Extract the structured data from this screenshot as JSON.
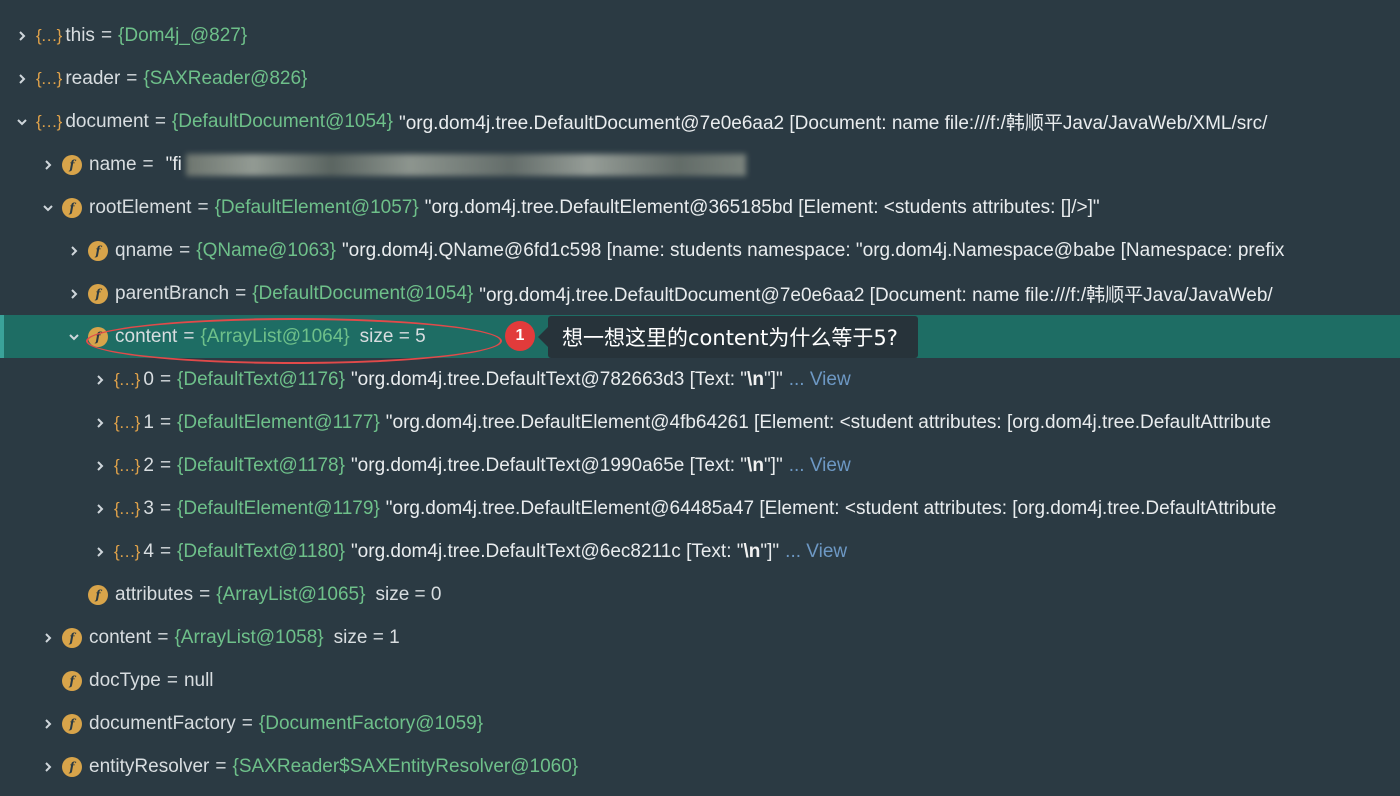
{
  "rows": [
    {
      "indent": 0,
      "arrow": "right",
      "icon": "obj",
      "key": "this",
      "ref": "{Dom4j_@827}"
    },
    {
      "indent": 0,
      "arrow": "right",
      "icon": "obj",
      "key": "reader",
      "ref": "{SAXReader@826}"
    },
    {
      "indent": 0,
      "arrow": "down",
      "icon": "obj",
      "key": "document",
      "ref": "{DefaultDocument@1054}",
      "str": "\"org.dom4j.tree.DefaultDocument@7e0e6aa2 [Document: name file:///f:/韩顺平Java/JavaWeb/XML/src/"
    },
    {
      "indent": 1,
      "arrow": "right",
      "icon": "field",
      "key": "name",
      "str": "\"fi",
      "blurred": true
    },
    {
      "indent": 1,
      "arrow": "down",
      "icon": "field",
      "key": "rootElement",
      "ref": "{DefaultElement@1057}",
      "str": "\"org.dom4j.tree.DefaultElement@365185bd [Element: <students attributes: []/>]\""
    },
    {
      "indent": 2,
      "arrow": "right",
      "icon": "field",
      "key": "qname",
      "ref": "{QName@1063}",
      "str": "\"org.dom4j.QName@6fd1c598 [name: students namespace: \"org.dom4j.Namespace@babe [Namespace: prefix"
    },
    {
      "indent": 2,
      "arrow": "right",
      "icon": "field",
      "key": "parentBranch",
      "ref": "{DefaultDocument@1054}",
      "str": "\"org.dom4j.tree.DefaultDocument@7e0e6aa2 [Document: name file:///f:/韩顺平Java/JavaWeb/"
    },
    {
      "indent": 2,
      "arrow": "down",
      "icon": "field",
      "key": "content",
      "ref": "{ArrayList@1064}",
      "size": "size = 5",
      "selected": true
    },
    {
      "indent": 3,
      "arrow": "right",
      "icon": "obj",
      "key": "0",
      "ref": "{DefaultText@1176}",
      "str": "\"org.dom4j.tree.DefaultText@782663d3 [Text: \"",
      "esc": "\\n",
      "str2": "    \"]\"",
      "view": "... View"
    },
    {
      "indent": 3,
      "arrow": "right",
      "icon": "obj",
      "key": "1",
      "ref": "{DefaultElement@1177}",
      "str": "\"org.dom4j.tree.DefaultElement@4fb64261 [Element: <student attributes: [org.dom4j.tree.DefaultAttribute"
    },
    {
      "indent": 3,
      "arrow": "right",
      "icon": "obj",
      "key": "2",
      "ref": "{DefaultText@1178}",
      "str": "\"org.dom4j.tree.DefaultText@1990a65e [Text: \"",
      "esc": "\\n",
      "str2": "    \"]\"",
      "view": "... View"
    },
    {
      "indent": 3,
      "arrow": "right",
      "icon": "obj",
      "key": "3",
      "ref": "{DefaultElement@1179}",
      "str": "\"org.dom4j.tree.DefaultElement@64485a47 [Element: <student attributes: [org.dom4j.tree.DefaultAttribute"
    },
    {
      "indent": 3,
      "arrow": "right",
      "icon": "obj",
      "key": "4",
      "ref": "{DefaultText@1180}",
      "str": "\"org.dom4j.tree.DefaultText@6ec8211c [Text: \"",
      "esc": "\\n",
      "str2": "\"]\"",
      "view": "... View"
    },
    {
      "indent": 2,
      "arrow": "none",
      "icon": "field",
      "key": "attributes",
      "ref": "{ArrayList@1065}",
      "size": "size = 0"
    },
    {
      "indent": 1,
      "arrow": "right",
      "icon": "field",
      "key": "content",
      "ref": "{ArrayList@1058}",
      "size": "size = 1"
    },
    {
      "indent": 1,
      "arrow": "none",
      "icon": "field",
      "key": "docType",
      "plain": "null"
    },
    {
      "indent": 1,
      "arrow": "right",
      "icon": "field",
      "key": "documentFactory",
      "ref": "{DocumentFactory@1059}"
    },
    {
      "indent": 1,
      "arrow": "right",
      "icon": "field",
      "key": "entityResolver",
      "ref": "{SAXReader$SAXEntityResolver@1060}"
    }
  ],
  "annotation": {
    "badge": "1",
    "callout": "想一想这里的content为什么等于5?"
  },
  "colors": {
    "background": "#2b3a43",
    "selected": "#1e6d64",
    "ref": "#6ec08a",
    "view": "#6d98c4",
    "field_icon": "#d8a44a",
    "annotation_red": "#e23b3b"
  }
}
